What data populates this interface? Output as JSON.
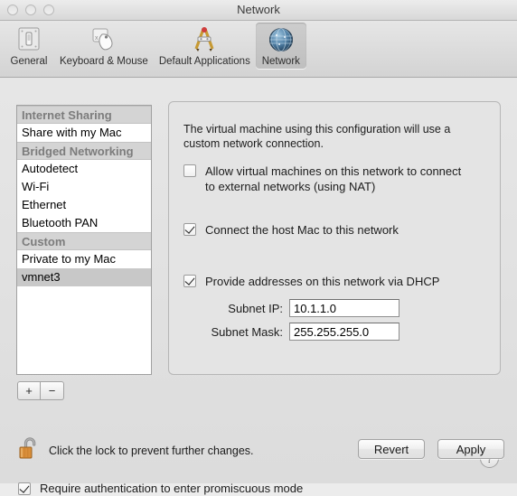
{
  "window": {
    "title": "Network",
    "traffic_lights": [
      "close",
      "minimize",
      "zoom"
    ]
  },
  "toolbar": {
    "items": [
      {
        "label": "General",
        "icon": "light-switch-icon",
        "selected": false
      },
      {
        "label": "Keyboard & Mouse",
        "icon": "mouse-icon",
        "selected": false
      },
      {
        "label": "Default Applications",
        "icon": "compass-divider-icon",
        "selected": false
      },
      {
        "label": "Network",
        "icon": "globe-icon",
        "selected": true
      }
    ]
  },
  "sidebar": {
    "rows": [
      {
        "label": "Internet Sharing",
        "type": "header"
      },
      {
        "label": "Share with my Mac",
        "type": "item",
        "selected": false
      },
      {
        "label": "Bridged Networking",
        "type": "header"
      },
      {
        "label": "Autodetect",
        "type": "item",
        "selected": false
      },
      {
        "label": "Wi-Fi",
        "type": "item",
        "selected": false
      },
      {
        "label": "Ethernet",
        "type": "item",
        "selected": false
      },
      {
        "label": "Bluetooth PAN",
        "type": "item",
        "selected": false
      },
      {
        "label": "Custom",
        "type": "header"
      },
      {
        "label": "Private to my Mac",
        "type": "item",
        "selected": false
      },
      {
        "label": "vmnet3",
        "type": "item",
        "selected": true
      }
    ],
    "add_label": "+",
    "remove_label": "−"
  },
  "panel": {
    "description": "The virtual machine using this configuration will use a custom network connection.",
    "checkboxes": [
      {
        "label": "Allow virtual machines on this network to connect to external networks (using NAT)",
        "checked": false
      },
      {
        "label": "Connect the host Mac to this network",
        "checked": true
      },
      {
        "label": "Provide addresses on this network via DHCP",
        "checked": true
      }
    ],
    "fields": [
      {
        "label": "Subnet IP:",
        "value": "10.1.1.0"
      },
      {
        "label": "Subnet Mask:",
        "value": "255.255.255.0"
      }
    ],
    "help_label": "?"
  },
  "options": {
    "promiscuous": {
      "label": "Require authentication to enter promiscuous mode",
      "checked": true
    }
  },
  "footer": {
    "lock_icon": "open-padlock-icon",
    "lock_message": "Click the lock to prevent further changes.",
    "buttons": [
      {
        "label": "Revert"
      },
      {
        "label": "Apply"
      }
    ]
  },
  "colors": {
    "window_bg": "#e4e4e4",
    "panel_bg": "#e4e4e4",
    "header_row": "#d4d4d4",
    "selected_row": "#c8c8c8",
    "lock_body": "#d98e3a"
  }
}
